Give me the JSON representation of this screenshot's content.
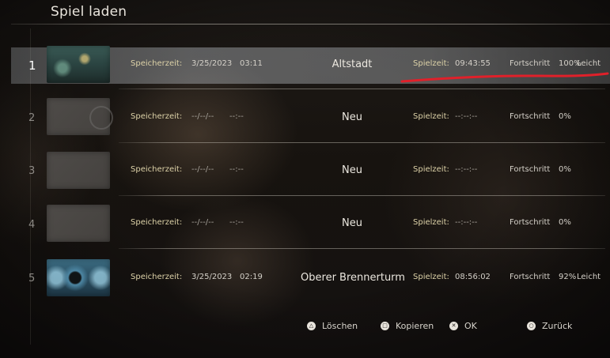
{
  "screen": {
    "title": "Spiel laden"
  },
  "labels": {
    "save_time": "Speicherzeit:",
    "play_time": "Spielzeit:",
    "progress": "Fortschritt"
  },
  "slots": [
    {
      "index": "1",
      "selected": true,
      "thumbnail": "old-town-scene",
      "date": "3/25/2023",
      "time": "03:11",
      "name": "Altstadt",
      "playtime": "09:43:55",
      "progress": "100%",
      "difficulty": "Leicht"
    },
    {
      "index": "2",
      "selected": false,
      "thumbnail": "empty",
      "date": "--/--/--",
      "time": "--:--",
      "name": "Neu",
      "playtime": "--:--:--",
      "progress": "0%",
      "difficulty": ""
    },
    {
      "index": "3",
      "selected": false,
      "thumbnail": "empty",
      "date": "--/--/--",
      "time": "--:--",
      "name": "Neu",
      "playtime": "--:--:--",
      "progress": "0%",
      "difficulty": ""
    },
    {
      "index": "4",
      "selected": false,
      "thumbnail": "empty",
      "date": "--/--/--",
      "time": "--:--",
      "name": "Neu",
      "playtime": "--:--:--",
      "progress": "0%",
      "difficulty": ""
    },
    {
      "index": "5",
      "selected": false,
      "thumbnail": "tower-scene",
      "date": "3/25/2023",
      "time": "02:19",
      "name": "Oberer Brennerturm",
      "playtime": "08:56:02",
      "progress": "92%",
      "difficulty": "Leicht"
    }
  ],
  "footer": {
    "delete": {
      "icon": "triangle-button-icon",
      "glyph": "△",
      "label": "Löschen"
    },
    "copy": {
      "icon": "square-button-icon",
      "glyph": "□",
      "label": "Kopieren"
    },
    "ok": {
      "icon": "cross-button-icon",
      "glyph": "✕",
      "label": "OK"
    },
    "back": {
      "icon": "circle-button-icon",
      "glyph": "○",
      "label": "Zurück"
    }
  },
  "annotation": {
    "color": "#e0202a"
  },
  "colors": {
    "label": "#ddd2a8",
    "text": "#d8d4cc"
  }
}
